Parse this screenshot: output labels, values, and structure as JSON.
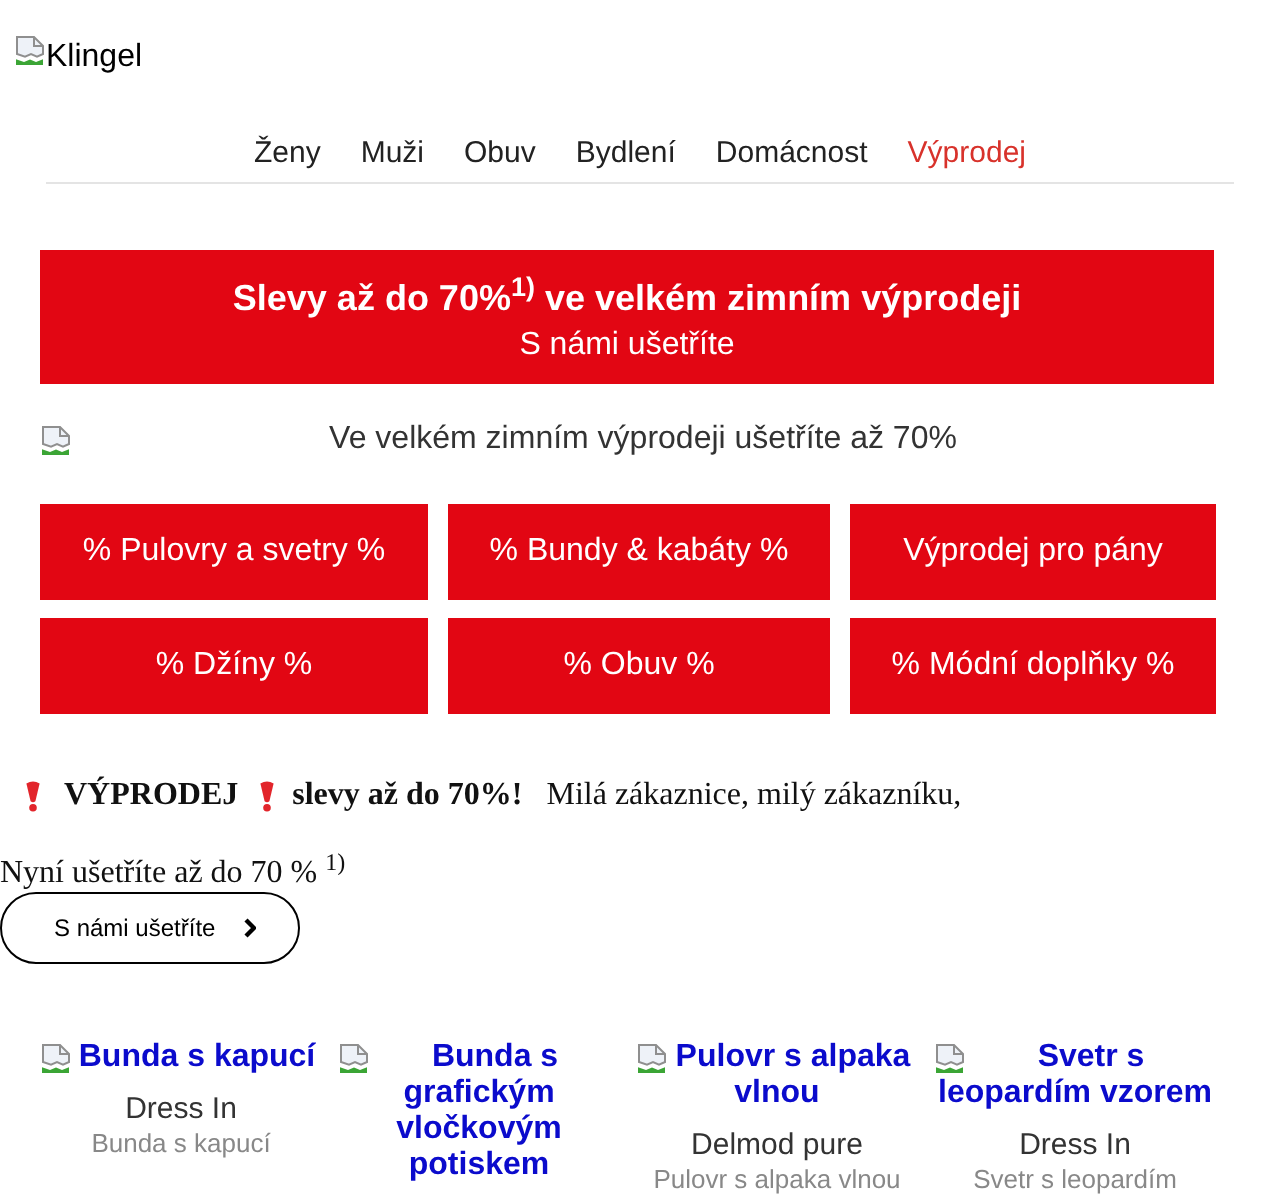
{
  "header": {
    "logo_text": "Klingel"
  },
  "nav": [
    {
      "label": "Ženy",
      "kind": "link"
    },
    {
      "label": "Muži",
      "kind": "link"
    },
    {
      "label": "Obuv",
      "kind": "link"
    },
    {
      "label": "Bydlení",
      "kind": "link"
    },
    {
      "label": "Domácnost",
      "kind": "link"
    },
    {
      "label": "Výprodej",
      "kind": "sale"
    }
  ],
  "banner": {
    "title": "Slevy až do 70%$^{1)}$ ve velkém zimním výprodeji",
    "subtitle": "S námi ušetříte"
  },
  "hero_image": {
    "alt_text": "Ve velkém zimním výprodeji ušetříte až 70%"
  },
  "category_buttons": [
    "% Pulovry a svetry %",
    "% Bundy & kabáty %",
    "Výprodej pro pány",
    "% Džíny %",
    "% Obuv %",
    "% Módní doplňky %"
  ],
  "intro": {
    "badge": "VÝPRODEJ",
    "text": "**slevy až do 70%!**   Milá zákaznice, milý zákazníku,",
    "savings_line": "Nyní ušetříte až do 70 % $^{1)}$"
  },
  "cta_button": {
    "label": "S námi ušetříte"
  },
  "products": [
    {
      "title": "Bunda s kapucí",
      "brand": "Dress In",
      "description": "Bunda s kapucí"
    },
    {
      "title": "Bunda s grafickým vločkovým potiskem"
    },
    {
      "title": "Pulovr s alpaka vlnou",
      "brand": "Delmod pure",
      "description": "Pulovr s alpaka vlnou"
    },
    {
      "title": "Svetr s leopardím vzorem",
      "brand": "Dress In",
      "description": "Svetr s leopardím"
    }
  ]
}
